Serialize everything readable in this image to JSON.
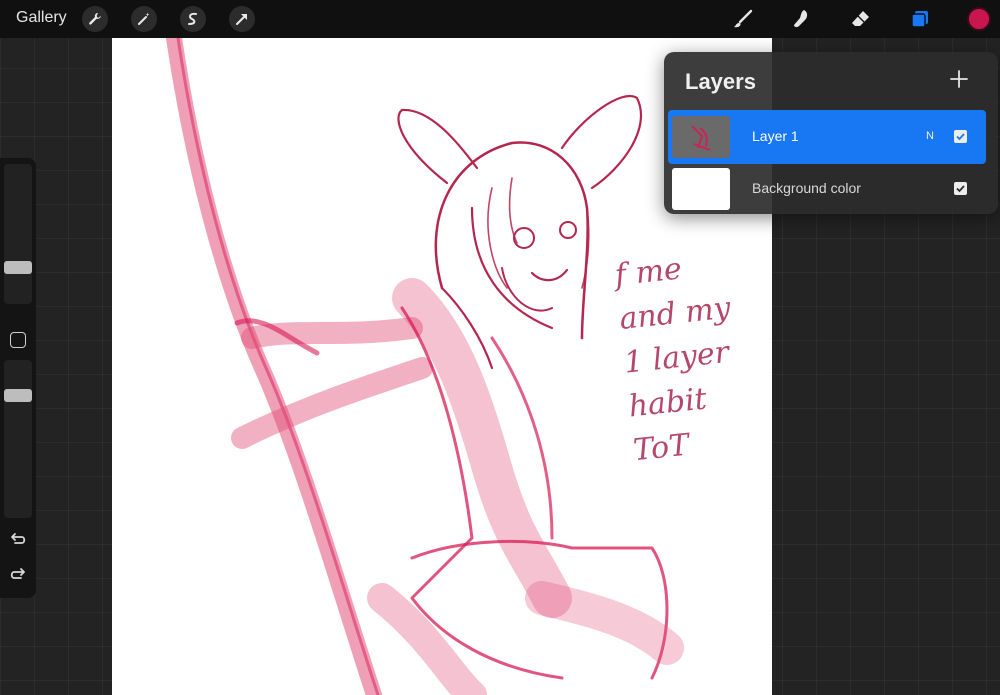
{
  "toolbar": {
    "gallery_label": "Gallery",
    "left_tools": [
      "wrench-icon",
      "magic-wand-icon",
      "selection-icon",
      "transform-arrow-icon"
    ],
    "right_tools": [
      "brush-icon",
      "smudge-icon",
      "eraser-icon",
      "layers-icon"
    ],
    "accent_color": "#1877f2",
    "current_color": "#c9164f"
  },
  "canvas": {
    "note": "f me\nand my\n1 layer\nhabit\nToT",
    "stroke_color": "#d81b55"
  },
  "layers_panel": {
    "title": "Layers",
    "layers": [
      {
        "name": "Layer 1",
        "blend_mode": "N",
        "visible": true,
        "selected": true
      },
      {
        "name": "Background color",
        "blend_mode": "",
        "visible": true,
        "selected": false
      }
    ]
  },
  "sidebar": {
    "brush_size_level": 0.24,
    "opacity_level": 0.8
  }
}
